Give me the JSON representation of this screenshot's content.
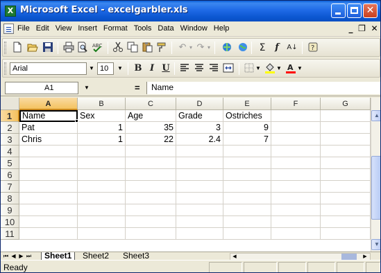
{
  "window": {
    "title": "Microsoft Excel - excelgarbler.xls",
    "app_icon": "excel-app-icon",
    "controls": {
      "minimize": "minimize-icon",
      "maximize": "maximize-icon",
      "close": "✕"
    },
    "doc_controls": {
      "minimize": "_",
      "restore": "❐",
      "close": "✕"
    }
  },
  "menu": {
    "items": [
      "File",
      "Edit",
      "View",
      "Insert",
      "Format",
      "Tools",
      "Data",
      "Window",
      "Help"
    ]
  },
  "toolbar_standard": {
    "icons": [
      "new-icon",
      "open-icon",
      "save-icon",
      "print-icon",
      "print-preview-icon",
      "spelling-icon",
      "cut-icon",
      "copy-icon",
      "paste-icon",
      "format-painter-icon",
      "undo-icon",
      "redo-icon",
      "hyperlink-icon",
      "web-toolbar-icon",
      "autosum-icon",
      "function-icon",
      "sort-ascending-icon",
      "help-icon"
    ],
    "sum_glyph": "Σ",
    "fx_glyph": "f",
    "sort_glyph": "A↓"
  },
  "toolbar_format": {
    "font": "Arial",
    "size": "10",
    "bold": "B",
    "italic": "I",
    "underline": "U",
    "fill_color": "#ffff00",
    "font_color": "#ff0000"
  },
  "formula_bar": {
    "name_box": "A1",
    "equals": "=",
    "content": "Name"
  },
  "sheet": {
    "columns": [
      "A",
      "B",
      "C",
      "D",
      "E",
      "F",
      "G"
    ],
    "rows": [
      "1",
      "2",
      "3",
      "4",
      "5",
      "6",
      "7",
      "8",
      "9",
      "10",
      "11"
    ],
    "cells": [
      [
        "Name",
        "Sex",
        "Age",
        "Grade",
        "Ostriches"
      ],
      [
        "Pat",
        "1",
        "35",
        "3",
        "9"
      ],
      [
        "Chris",
        "1",
        "22",
        "2.4",
        "7"
      ]
    ],
    "active_cell": "A1"
  },
  "tabs": {
    "sheets": [
      "Sheet1",
      "Sheet2",
      "Sheet3"
    ],
    "active": "Sheet1"
  },
  "status": {
    "text": "Ready"
  }
}
